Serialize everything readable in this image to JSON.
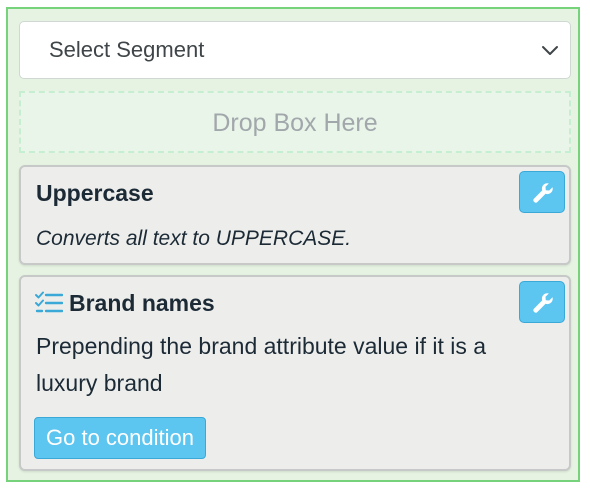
{
  "segment_select": {
    "selected_value": "Select Segment",
    "icon": "chevron-down-icon"
  },
  "drop_zone": {
    "label": "Drop Box Here"
  },
  "cards": [
    {
      "title": "Uppercase",
      "description": "Converts all text to UPPERCASE.",
      "action_icon": "wrench-icon"
    },
    {
      "title": "Brand names",
      "title_icon": "checklist-icon",
      "description": "Prepending the brand attribute value if it is a luxury brand",
      "action_icon": "wrench-icon",
      "button_label": "Go to condition"
    }
  ],
  "colors": {
    "accent": "#5cc5f0",
    "panel_border": "#76d27b",
    "panel_background": "#e6f3e2",
    "card_background": "#edeeec",
    "text_dark": "#1c2a36"
  }
}
